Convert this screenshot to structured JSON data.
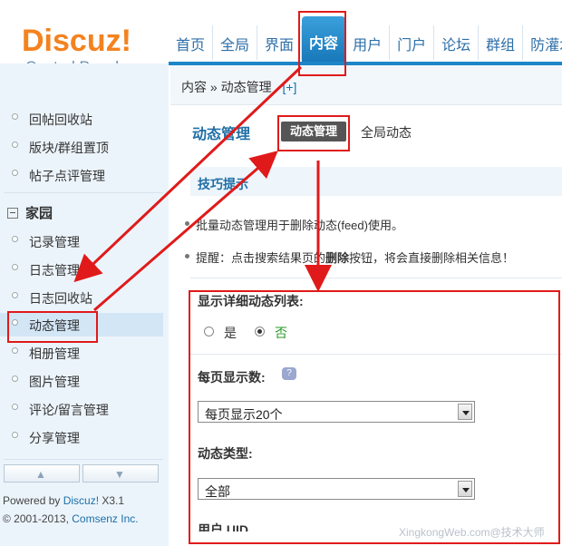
{
  "logo": {
    "main": "Discuz!",
    "sub": "Control Panel"
  },
  "topnav": [
    "首页",
    "全局",
    "界面",
    "内容",
    "用户",
    "门户",
    "论坛",
    "群组",
    "防灌水"
  ],
  "breadcrumb": {
    "section": "内容",
    "separator": "»",
    "page": "动态管理",
    "add": "[+]"
  },
  "sidebar": {
    "items_top": [
      "回帖回收站",
      "版块/群组置顶",
      "帖子点评管理"
    ],
    "group": "家园",
    "items": [
      "记录管理",
      "日志管理",
      "日志回收站",
      "动态管理",
      "相册管理",
      "图片管理",
      "评论/留言管理",
      "分享管理"
    ],
    "active_item": "动态管理",
    "up_icon": "arrow-up-icon",
    "down_icon": "arrow-down-icon"
  },
  "footer": {
    "powered_prefix": "Powered by ",
    "powered_link": "Discuz!",
    "powered_version": " X3.1",
    "copyright_prefix": "© 2001-2013, ",
    "copyright_link": "Comsenz Inc."
  },
  "main": {
    "page_title": "动态管理",
    "tab_active": "动态管理",
    "tab_other": "全局动态",
    "tips_title": "技巧提示",
    "tip1": "批量动态管理用于删除动态(feed)使用。",
    "tip2_prefix": "提醒：点击搜索结果页的",
    "tip2_bold": "删除",
    "tip2_suffix": "按钮，将会直接删除相关信息！",
    "show_detail_label": "显示详细动态列表:",
    "radio_yes": "是",
    "radio_no": "否",
    "per_page_label": "每页显示数:",
    "per_page_value": "每页显示20个",
    "type_label": "动态类型:",
    "type_value": "全部",
    "uid_label_cut": "用户 UID"
  },
  "watermark": "XingkongWeb.com@技术大师",
  "colors": {
    "accent": "#1c86c8",
    "annotation": "#e01a1a",
    "logo": "#f4821f"
  }
}
